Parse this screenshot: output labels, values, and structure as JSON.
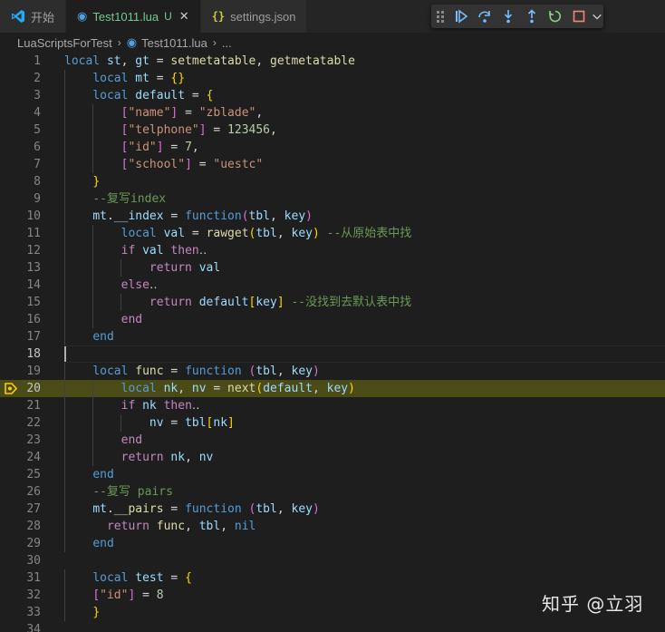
{
  "tabs": [
    {
      "label": "开始",
      "icon": "vscode-icon",
      "status": "",
      "active": false
    },
    {
      "label": "Test1011.lua",
      "icon": "lua-file-icon",
      "status": "U",
      "active": true
    },
    {
      "label": "settings.json",
      "icon": "json-file-icon",
      "status": "",
      "active": false
    }
  ],
  "tab_close_glyph": "✕",
  "debug_toolbar": [
    {
      "name": "continue-icon"
    },
    {
      "name": "step-over-icon"
    },
    {
      "name": "step-into-icon"
    },
    {
      "name": "step-out-icon"
    },
    {
      "name": "restart-icon"
    },
    {
      "name": "stop-icon"
    }
  ],
  "breadcrumb": {
    "folder": "LuaScriptsForTest",
    "file": "Test1011.lua",
    "more": "..."
  },
  "editor": {
    "current_line": 20,
    "cursor_line": 18,
    "lines": [
      {
        "n": "1",
        "tokens": [
          [
            "kw",
            "local"
          ],
          [
            "punc",
            " "
          ],
          [
            "var",
            "st"
          ],
          [
            "punc",
            ", "
          ],
          [
            "var",
            "gt"
          ],
          [
            "punc",
            " = "
          ],
          [
            "fn",
            "setmetatable"
          ],
          [
            "punc",
            ", "
          ],
          [
            "fn",
            "getmetatable"
          ]
        ]
      },
      {
        "n": "2",
        "tokens": [
          [
            "punc",
            "    "
          ],
          [
            "kw",
            "local"
          ],
          [
            "punc",
            " "
          ],
          [
            "var",
            "mt"
          ],
          [
            "punc",
            " = "
          ],
          [
            "brk",
            "{}"
          ]
        ]
      },
      {
        "n": "3",
        "tokens": [
          [
            "punc",
            "    "
          ],
          [
            "kw",
            "local"
          ],
          [
            "punc",
            " "
          ],
          [
            "var",
            "default"
          ],
          [
            "punc",
            " = "
          ],
          [
            "brk",
            "{"
          ]
        ]
      },
      {
        "n": "4",
        "tokens": [
          [
            "punc",
            "        "
          ],
          [
            "brk2",
            "["
          ],
          [
            "str",
            "\"name\""
          ],
          [
            "brk2",
            "]"
          ],
          [
            "punc",
            " = "
          ],
          [
            "str",
            "\"zblade\""
          ],
          [
            "punc",
            ","
          ]
        ]
      },
      {
        "n": "5",
        "tokens": [
          [
            "punc",
            "        "
          ],
          [
            "brk2",
            "["
          ],
          [
            "str",
            "\"telphone\""
          ],
          [
            "brk2",
            "]"
          ],
          [
            "punc",
            " = "
          ],
          [
            "num",
            "123456"
          ],
          [
            "punc",
            ","
          ]
        ]
      },
      {
        "n": "6",
        "tokens": [
          [
            "punc",
            "        "
          ],
          [
            "brk2",
            "["
          ],
          [
            "str",
            "\"id\""
          ],
          [
            "brk2",
            "]"
          ],
          [
            "punc",
            " = "
          ],
          [
            "num",
            "7"
          ],
          [
            "punc",
            ","
          ]
        ]
      },
      {
        "n": "7",
        "tokens": [
          [
            "punc",
            "        "
          ],
          [
            "brk2",
            "["
          ],
          [
            "str",
            "\"school\""
          ],
          [
            "brk2",
            "]"
          ],
          [
            "punc",
            " = "
          ],
          [
            "str",
            "\"uestc\""
          ]
        ]
      },
      {
        "n": "8",
        "tokens": [
          [
            "punc",
            "    "
          ],
          [
            "brk",
            "}"
          ]
        ]
      },
      {
        "n": "9",
        "tokens": [
          [
            "punc",
            "    "
          ],
          [
            "cmt",
            "--复写index"
          ]
        ]
      },
      {
        "n": "10",
        "tokens": [
          [
            "punc",
            "    "
          ],
          [
            "var",
            "mt"
          ],
          [
            "punc",
            "."
          ],
          [
            "var",
            "__index"
          ],
          [
            "punc",
            " = "
          ],
          [
            "kw",
            "function"
          ],
          [
            "brk2",
            "("
          ],
          [
            "param",
            "tbl"
          ],
          [
            "punc",
            ", "
          ],
          [
            "param",
            "key"
          ],
          [
            "brk2",
            ")"
          ]
        ]
      },
      {
        "n": "11",
        "tokens": [
          [
            "punc",
            "        "
          ],
          [
            "kw",
            "local"
          ],
          [
            "punc",
            " "
          ],
          [
            "var",
            "val"
          ],
          [
            "punc",
            " = "
          ],
          [
            "fn",
            "rawget"
          ],
          [
            "brk",
            "("
          ],
          [
            "param",
            "tbl"
          ],
          [
            "punc",
            ", "
          ],
          [
            "param",
            "key"
          ],
          [
            "brk",
            ")"
          ],
          [
            "punc",
            " "
          ],
          [
            "cmt",
            "--从原始表中找"
          ]
        ]
      },
      {
        "n": "12",
        "tokens": [
          [
            "punc",
            "        "
          ],
          [
            "ctl",
            "if"
          ],
          [
            "punc",
            " "
          ],
          [
            "var",
            "val"
          ],
          [
            "punc",
            " "
          ],
          [
            "ctl",
            "then"
          ],
          [
            "punc",
            "‥"
          ]
        ]
      },
      {
        "n": "13",
        "tokens": [
          [
            "punc",
            "            "
          ],
          [
            "ctl",
            "return"
          ],
          [
            "punc",
            " "
          ],
          [
            "var",
            "val"
          ]
        ]
      },
      {
        "n": "14",
        "tokens": [
          [
            "punc",
            "        "
          ],
          [
            "ctl",
            "else"
          ],
          [
            "punc",
            "‥"
          ]
        ]
      },
      {
        "n": "15",
        "tokens": [
          [
            "punc",
            "            "
          ],
          [
            "ctl",
            "return"
          ],
          [
            "punc",
            " "
          ],
          [
            "var",
            "default"
          ],
          [
            "brk",
            "["
          ],
          [
            "param",
            "key"
          ],
          [
            "brk",
            "]"
          ],
          [
            "punc",
            " "
          ],
          [
            "cmt",
            "--没找到去默认表中找"
          ]
        ]
      },
      {
        "n": "16",
        "tokens": [
          [
            "punc",
            "        "
          ],
          [
            "ctl",
            "end"
          ]
        ]
      },
      {
        "n": "17",
        "tokens": [
          [
            "punc",
            "    "
          ],
          [
            "kw",
            "end"
          ]
        ]
      },
      {
        "n": "18",
        "tokens": []
      },
      {
        "n": "19",
        "tokens": [
          [
            "punc",
            "    "
          ],
          [
            "kw",
            "local"
          ],
          [
            "punc",
            " "
          ],
          [
            "fn",
            "func"
          ],
          [
            "punc",
            " = "
          ],
          [
            "kw",
            "function"
          ],
          [
            "punc",
            " "
          ],
          [
            "brk2",
            "("
          ],
          [
            "param",
            "tbl"
          ],
          [
            "punc",
            ", "
          ],
          [
            "param",
            "key"
          ],
          [
            "brk2",
            ")"
          ]
        ]
      },
      {
        "n": "20",
        "tokens": [
          [
            "punc",
            "        "
          ],
          [
            "kw",
            "local"
          ],
          [
            "punc",
            " "
          ],
          [
            "var",
            "nk"
          ],
          [
            "punc",
            ", "
          ],
          [
            "var",
            "nv"
          ],
          [
            "punc",
            " = "
          ],
          [
            "fn",
            "next"
          ],
          [
            "brk",
            "("
          ],
          [
            "var",
            "default"
          ],
          [
            "punc",
            ", "
          ],
          [
            "param",
            "key"
          ],
          [
            "brk",
            ")"
          ]
        ]
      },
      {
        "n": "21",
        "tokens": [
          [
            "punc",
            "        "
          ],
          [
            "ctl",
            "if"
          ],
          [
            "punc",
            " "
          ],
          [
            "var",
            "nk"
          ],
          [
            "punc",
            " "
          ],
          [
            "ctl",
            "then"
          ],
          [
            "punc",
            "‥"
          ]
        ]
      },
      {
        "n": "22",
        "tokens": [
          [
            "punc",
            "            "
          ],
          [
            "var",
            "nv"
          ],
          [
            "punc",
            " = "
          ],
          [
            "param",
            "tbl"
          ],
          [
            "brk",
            "["
          ],
          [
            "var",
            "nk"
          ],
          [
            "brk",
            "]"
          ]
        ]
      },
      {
        "n": "23",
        "tokens": [
          [
            "punc",
            "        "
          ],
          [
            "ctl",
            "end"
          ]
        ]
      },
      {
        "n": "24",
        "tokens": [
          [
            "punc",
            "        "
          ],
          [
            "ctl",
            "return"
          ],
          [
            "punc",
            " "
          ],
          [
            "var",
            "nk"
          ],
          [
            "punc",
            ", "
          ],
          [
            "var",
            "nv"
          ]
        ]
      },
      {
        "n": "25",
        "tokens": [
          [
            "punc",
            "    "
          ],
          [
            "kw",
            "end"
          ]
        ]
      },
      {
        "n": "26",
        "tokens": [
          [
            "punc",
            "    "
          ],
          [
            "cmt",
            "--复写 pairs"
          ]
        ]
      },
      {
        "n": "27",
        "tokens": [
          [
            "punc",
            "    "
          ],
          [
            "var",
            "mt"
          ],
          [
            "punc",
            "."
          ],
          [
            "fn",
            "__pairs"
          ],
          [
            "punc",
            " = "
          ],
          [
            "kw",
            "function"
          ],
          [
            "punc",
            " "
          ],
          [
            "brk2",
            "("
          ],
          [
            "param",
            "tbl"
          ],
          [
            "punc",
            ", "
          ],
          [
            "param",
            "key"
          ],
          [
            "brk2",
            ")"
          ]
        ]
      },
      {
        "n": "28",
        "tokens": [
          [
            "punc",
            "      "
          ],
          [
            "ctl",
            "return"
          ],
          [
            "punc",
            " "
          ],
          [
            "fn",
            "func"
          ],
          [
            "punc",
            ", "
          ],
          [
            "param",
            "tbl"
          ],
          [
            "punc",
            ", "
          ],
          [
            "kw",
            "nil"
          ]
        ]
      },
      {
        "n": "29",
        "tokens": [
          [
            "punc",
            "    "
          ],
          [
            "kw",
            "end"
          ]
        ]
      },
      {
        "n": "30",
        "tokens": []
      },
      {
        "n": "31",
        "tokens": [
          [
            "punc",
            "    "
          ],
          [
            "kw",
            "local"
          ],
          [
            "punc",
            " "
          ],
          [
            "var",
            "test"
          ],
          [
            "punc",
            " = "
          ],
          [
            "brk",
            "{"
          ]
        ]
      },
      {
        "n": "32",
        "tokens": [
          [
            "punc",
            "    "
          ],
          [
            "brk2",
            "["
          ],
          [
            "str",
            "\"id\""
          ],
          [
            "brk2",
            "]"
          ],
          [
            "punc",
            " = "
          ],
          [
            "num",
            "8"
          ]
        ]
      },
      {
        "n": "33",
        "tokens": [
          [
            "punc",
            "    "
          ],
          [
            "brk",
            "}"
          ]
        ]
      },
      {
        "n": "34",
        "tokens": []
      }
    ]
  },
  "watermark": "知乎 @立羽"
}
